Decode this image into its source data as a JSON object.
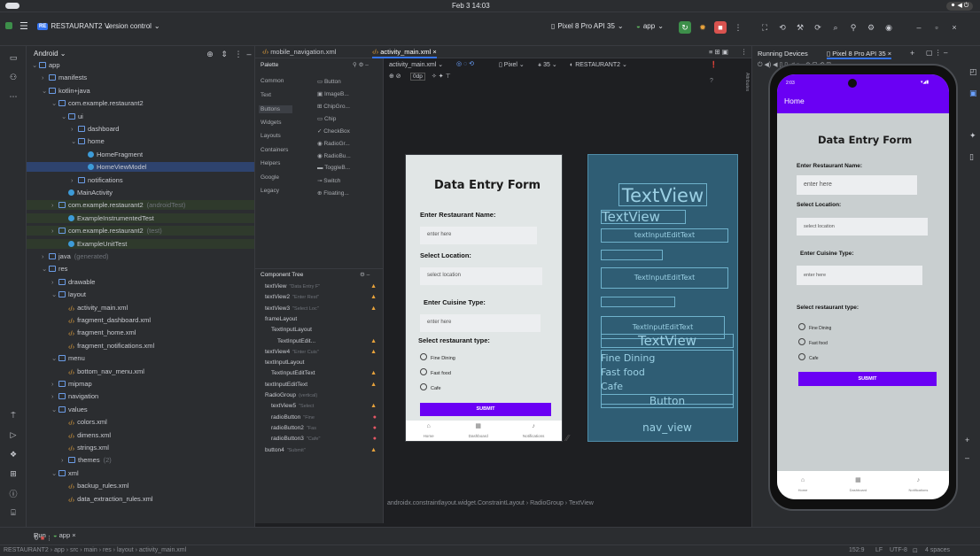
{
  "system": {
    "time": "Feb 3 14:03"
  },
  "toolbar": {
    "project_badge": "RE",
    "project_name": "RESTAURANT2",
    "vcs": "Version control",
    "device": "Pixel 8 Pro API 35",
    "run_config": "app"
  },
  "sidebar": {
    "title": "Android",
    "items": [
      {
        "label": "app",
        "indent": 0,
        "kind": "folder",
        "expanded": true
      },
      {
        "label": "manifests",
        "indent": 1,
        "kind": "folder"
      },
      {
        "label": "kotlin+java",
        "indent": 1,
        "kind": "folder",
        "expanded": true
      },
      {
        "label": "com.example.restaurant2",
        "indent": 2,
        "kind": "pkg",
        "expanded": true
      },
      {
        "label": "ui",
        "indent": 3,
        "kind": "pkg",
        "expanded": true
      },
      {
        "label": "dashboard",
        "indent": 4,
        "kind": "pkg"
      },
      {
        "label": "home",
        "indent": 4,
        "kind": "pkg",
        "expanded": true
      },
      {
        "label": "HomeFragment",
        "indent": 5,
        "kind": "class"
      },
      {
        "label": "HomeViewModel",
        "indent": 5,
        "kind": "class",
        "selected": true
      },
      {
        "label": "notifications",
        "indent": 4,
        "kind": "pkg"
      },
      {
        "label": "MainActivity",
        "indent": 3,
        "kind": "class"
      },
      {
        "label": "com.example.restaurant2",
        "suffix": "(androidTest)",
        "indent": 2,
        "kind": "pkg",
        "green": true
      },
      {
        "label": "ExampleInstrumentedTest",
        "indent": 3,
        "kind": "class",
        "green": true
      },
      {
        "label": "com.example.restaurant2",
        "suffix": "(test)",
        "indent": 2,
        "kind": "pkg",
        "green": true
      },
      {
        "label": "ExampleUnitTest",
        "indent": 3,
        "kind": "class",
        "green": true
      },
      {
        "label": "java",
        "suffix": "(generated)",
        "indent": 1,
        "kind": "folder"
      },
      {
        "label": "res",
        "indent": 1,
        "kind": "folder",
        "expanded": true
      },
      {
        "label": "drawable",
        "indent": 2,
        "kind": "pkg"
      },
      {
        "label": "layout",
        "indent": 2,
        "kind": "pkg",
        "expanded": true
      },
      {
        "label": "activity_main.xml",
        "indent": 3,
        "kind": "xml"
      },
      {
        "label": "fragment_dashboard.xml",
        "indent": 3,
        "kind": "xml"
      },
      {
        "label": "fragment_home.xml",
        "indent": 3,
        "kind": "xml"
      },
      {
        "label": "fragment_notifications.xml",
        "indent": 3,
        "kind": "xml"
      },
      {
        "label": "menu",
        "indent": 2,
        "kind": "pkg",
        "expanded": true
      },
      {
        "label": "bottom_nav_menu.xml",
        "indent": 3,
        "kind": "xml"
      },
      {
        "label": "mipmap",
        "indent": 2,
        "kind": "pkg"
      },
      {
        "label": "navigation",
        "indent": 2,
        "kind": "pkg"
      },
      {
        "label": "values",
        "indent": 2,
        "kind": "pkg",
        "expanded": true
      },
      {
        "label": "colors.xml",
        "indent": 3,
        "kind": "xml"
      },
      {
        "label": "dimens.xml",
        "indent": 3,
        "kind": "xml"
      },
      {
        "label": "strings.xml",
        "indent": 3,
        "kind": "xml"
      },
      {
        "label": "themes",
        "suffix": "(2)",
        "indent": 3,
        "kind": "pkg"
      },
      {
        "label": "xml",
        "indent": 2,
        "kind": "pkg",
        "expanded": true
      },
      {
        "label": "backup_rules.xml",
        "indent": 3,
        "kind": "xml"
      },
      {
        "label": "data_extraction_rules.xml",
        "indent": 3,
        "kind": "xml"
      }
    ]
  },
  "editor": {
    "tabs": [
      "mobile_navigation.xml",
      "activity_main.xml"
    ],
    "palette": {
      "title": "Palette",
      "categories": [
        "Common",
        "Text",
        "Buttons",
        "Widgets",
        "Layouts",
        "Containers",
        "Helpers",
        "Google",
        "Legacy"
      ],
      "widgets": [
        "Button",
        "ImageB...",
        "ChipGro...",
        "Chip",
        "CheckBox",
        "RadioGr...",
        "RadioBu...",
        "ToggleB...",
        "Switch",
        "Floating..."
      ]
    },
    "component_tree": {
      "title": "Component Tree",
      "rows": [
        {
          "label": "textView",
          "hint": "\"Data Entry F\"",
          "indent": 1,
          "mark": "warn"
        },
        {
          "label": "textView2",
          "hint": "\"Enter Rest\"",
          "indent": 1,
          "mark": "warn"
        },
        {
          "label": "textView3",
          "hint": "\"Select Loc\"",
          "indent": 1,
          "mark": "warn"
        },
        {
          "label": "frameLayout",
          "hint": "",
          "indent": 1,
          "mark": ""
        },
        {
          "label": "TextInputLayout",
          "hint": "",
          "indent": 2,
          "mark": ""
        },
        {
          "label": "TextInputEdit...",
          "hint": "",
          "indent": 3,
          "mark": "warn"
        },
        {
          "label": "textView4",
          "hint": "\"Enter Cuis\"",
          "indent": 1,
          "mark": "warn"
        },
        {
          "label": "textInputLayout",
          "hint": "",
          "indent": 1,
          "mark": ""
        },
        {
          "label": "TextInputEditText",
          "hint": "",
          "indent": 2,
          "mark": "warn"
        },
        {
          "label": "textInputEditText",
          "hint": "",
          "indent": 1,
          "mark": "warn"
        },
        {
          "label": "RadioGroup",
          "hint": "(vertical)",
          "indent": 1,
          "mark": ""
        },
        {
          "label": "textView5",
          "hint": "\"Select",
          "indent": 2,
          "mark": "warn"
        },
        {
          "label": "radioButton",
          "hint": "\"Fine",
          "indent": 2,
          "mark": "err"
        },
        {
          "label": "radioButton2",
          "hint": "\"Fas",
          "indent": 2,
          "mark": "err"
        },
        {
          "label": "radioButton3",
          "hint": "\"Cafe\"",
          "indent": 2,
          "mark": "err"
        },
        {
          "label": "button4",
          "hint": "\"Submit\"",
          "indent": 1,
          "mark": "warn"
        }
      ]
    },
    "canvas_toolbar": {
      "file": "activity_main.xml",
      "dp": "0dp",
      "device": "Pixel",
      "api": "35",
      "theme": "RESTAURANT2"
    },
    "breadcrumb": [
      "androidx.constraintlayout.widget.ConstraintLayout",
      "RadioGroup",
      "TextView"
    ],
    "side_label": "Attributes"
  },
  "form": {
    "title": "Data Entry Form",
    "name_label": "Enter Restaurant Name:",
    "name_placeholder": "enter here",
    "location_label": "Select Location:",
    "location_placeholder": "select location",
    "cuisine_label": "Enter Cuisine Type:",
    "cuisine_placeholder": "enter here",
    "type_label": "Select restaurant type:",
    "options": [
      "Fine Dining",
      "Fast food",
      "Cafe"
    ],
    "submit": "SUBMIT",
    "nav": [
      "Home",
      "Dashboard",
      "Notifications"
    ]
  },
  "blueprint": {
    "texts": [
      "TextView",
      "textInputEditText",
      "TextInputEditText",
      "TextInputEditText",
      "TextView",
      "Fine Dining",
      "Fast food",
      "Cafe",
      "Button",
      "nav_view"
    ]
  },
  "running": {
    "title": "Running Devices",
    "device_tab": "Pixel 8 Pro API 35",
    "app_bar_title": "Home",
    "status_time": "2:03"
  },
  "bottom": {
    "run_label": "Run",
    "run_config": "app"
  },
  "statusbar": {
    "path": [
      "RESTAURANT2",
      "app",
      "src",
      "main",
      "res",
      "layout",
      "activity_main.xml"
    ],
    "position": "152:9",
    "line_ending": "LF",
    "encoding": "UTF-8",
    "indent": "4 spaces"
  },
  "colors": {
    "accent": "#6a00f4",
    "panel": "#2b2d30",
    "editor": "#1e1f22",
    "blueprint": "#2f5d74"
  }
}
